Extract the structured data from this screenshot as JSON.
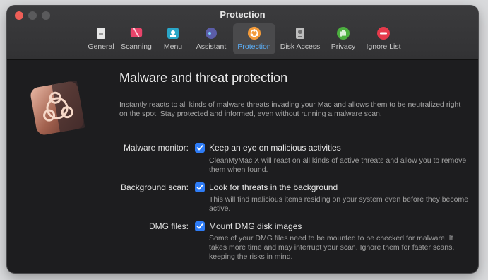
{
  "window": {
    "title": "Protection"
  },
  "tabs": [
    {
      "label": "General",
      "icon": "general-icon"
    },
    {
      "label": "Scanning",
      "icon": "scanning-icon"
    },
    {
      "label": "Menu",
      "icon": "menu-icon"
    },
    {
      "label": "Assistant",
      "icon": "assistant-icon"
    },
    {
      "label": "Protection",
      "icon": "biohazard-icon",
      "active": true
    },
    {
      "label": "Disk Access",
      "icon": "disk-icon"
    },
    {
      "label": "Privacy",
      "icon": "hand-icon"
    },
    {
      "label": "Ignore List",
      "icon": "no-entry-icon"
    }
  ],
  "content": {
    "heading": "Malware and threat protection",
    "description": "Instantly reacts to all kinds of malware threats invading your Mac and allows them to be neutralized right on the spot. Stay protected and informed, even without running a malware scan.",
    "options": [
      {
        "label": "Malware monitor:",
        "checkbox_label": "Keep an eye on malicious activities",
        "checked": true,
        "description": "CleanMyMac X will react on all kinds of active threats and allow you to remove them when found."
      },
      {
        "label": "Background scan:",
        "checkbox_label": "Look for threats in the background",
        "checked": true,
        "description": "This will find malicious items residing on your system even before they become active."
      },
      {
        "label": "DMG files:",
        "checkbox_label": "Mount DMG disk images",
        "checked": true,
        "description": "Some of your DMG files need to be mounted to be checked for malware. It takes more time and may interrupt your scan. Ignore them for faster scans, keeping the risks in mind."
      }
    ]
  },
  "colors": {
    "accent": "#2e7cf6",
    "active_tab_label": "#5cb3ff",
    "close_button": "#ee5e57"
  }
}
